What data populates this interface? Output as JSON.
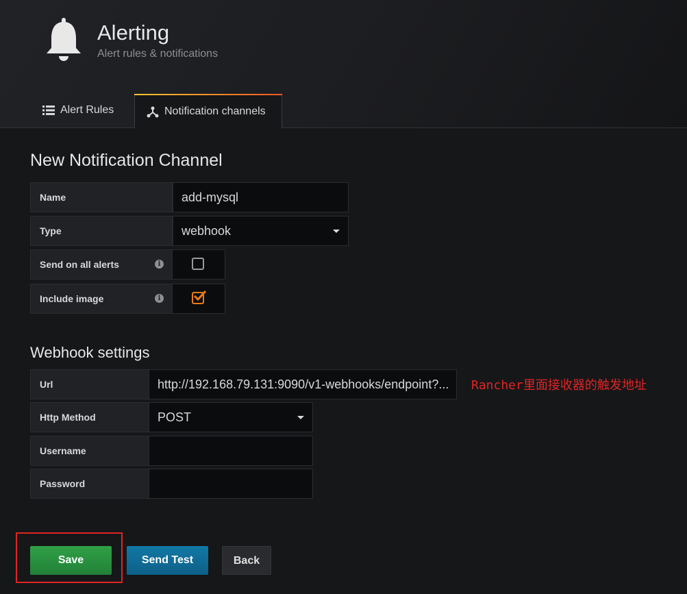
{
  "header": {
    "title": "Alerting",
    "subtitle": "Alert rules & notifications",
    "icon": "bell-icon"
  },
  "tabs": [
    {
      "label": "Alert Rules",
      "icon": "list-icon",
      "active": false
    },
    {
      "label": "Notification channels",
      "icon": "share-icon",
      "active": true
    }
  ],
  "form": {
    "title": "New Notification Channel",
    "name_label": "Name",
    "name_value": "add-mysql",
    "type_label": "Type",
    "type_value": "webhook",
    "send_all_label": "Send on all alerts",
    "send_all_checked": false,
    "include_image_label": "Include image",
    "include_image_checked": true
  },
  "webhook": {
    "title": "Webhook settings",
    "url_label": "Url",
    "url_value": "http://192.168.79.131:9090/v1-webhooks/endpoint?...",
    "method_label": "Http Method",
    "method_value": "POST",
    "username_label": "Username",
    "username_value": "",
    "password_label": "Password",
    "password_value": ""
  },
  "annotation": "Rancher里面接收器的触发地址",
  "buttons": {
    "save": "Save",
    "send_test": "Send Test",
    "back": "Back"
  },
  "colors": {
    "accent_orange": "#eb7b18",
    "save_green": "#299c46",
    "send_blue": "#1273a0",
    "annotation_red": "#e02424"
  }
}
